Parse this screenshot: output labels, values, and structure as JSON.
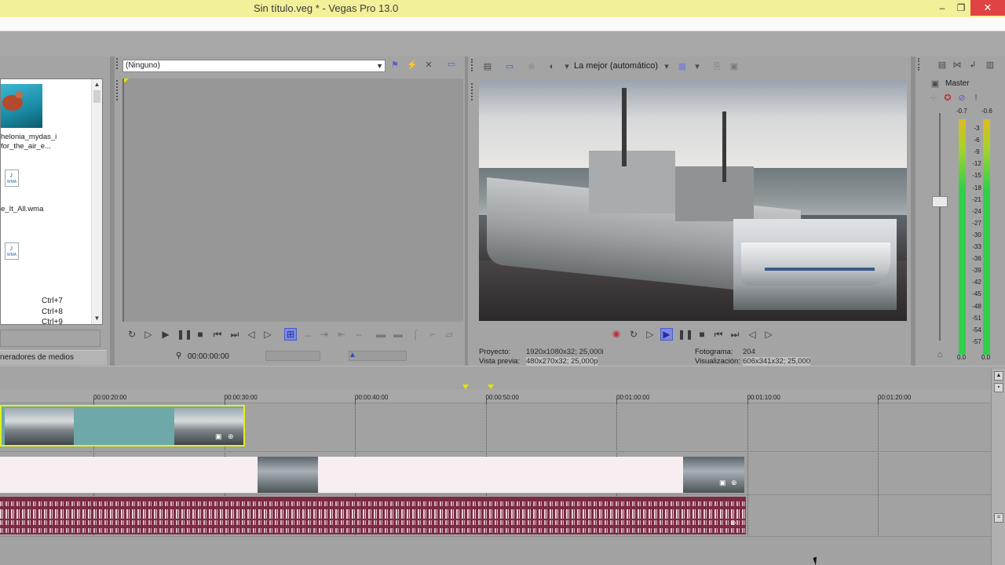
{
  "window": {
    "title": "Sin título.veg * - Vegas Pro 13.0",
    "minimize": "‒",
    "restore": "❐",
    "close": "✕"
  },
  "explorer": {
    "files": [
      {
        "name_line1": "helonia_mydas_i",
        "name_line2": "for_the_air_e...",
        "type": "video"
      },
      {
        "name_line1": "e_It_All.wma",
        "type": "wma"
      },
      {
        "name_line1": "",
        "type": "wma"
      }
    ],
    "wma_badge": "WMA",
    "shortcuts": [
      "Ctrl+7",
      "Ctrl+8",
      "Ctrl+9"
    ],
    "tab_label": "neradores de medios"
  },
  "trimmer": {
    "source_select": "(Ninguno)",
    "timecode": "00:00:00:00"
  },
  "preview": {
    "quality": "La mejor (automático)",
    "project_label": "Proyecto:",
    "project_value": "1920x1080x32; 25,000i",
    "preview_label": "Vista previa:",
    "preview_value": "480x270x32; 25,000p",
    "frame_label": "Fotograma:",
    "frame_value": "204",
    "display_label": "Visualización:",
    "display_value": "606x341x32; 25,000"
  },
  "mixer": {
    "master_label": "Master",
    "peak_left": "-0.7",
    "peak_right": "-0.6",
    "scale": [
      "3",
      "6",
      "9",
      "12",
      "15",
      "18",
      "21",
      "24",
      "27",
      "30",
      "33",
      "36",
      "39",
      "42",
      "45",
      "48",
      "51",
      "54",
      "57"
    ],
    "bottom_left": "0.0",
    "bottom_right": "0.0"
  },
  "timeline": {
    "ruler_labels": [
      "00:00:20:00",
      "00:00:30:00",
      "00:00:40:00",
      "00:00:50:00",
      "00:01:00:00",
      "00:01:10:00",
      "00:01:20:00"
    ]
  }
}
